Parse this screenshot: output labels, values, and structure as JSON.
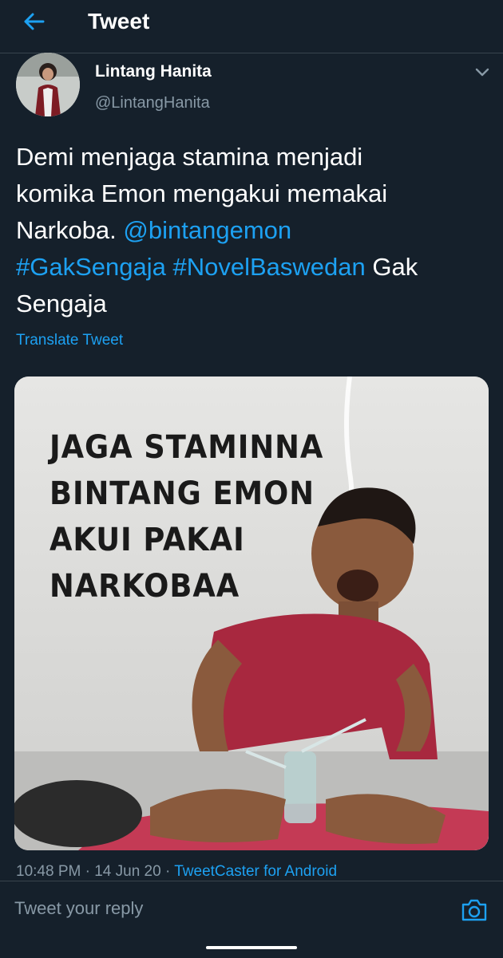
{
  "header": {
    "title": "Tweet"
  },
  "author": {
    "name": "Lintang Hanita",
    "handle": "@LintangHanita"
  },
  "tweet": {
    "line1": "Demi menjaga stamina menjadi",
    "line2": "komika Emon mengakui memakai",
    "line3a": "Narkoba.  ",
    "mention": "@bintangemon",
    "hashtag1": "#GakSengaja",
    "hashtag2": "#NovelBaswedan",
    "line4b": " Gak",
    "line5": "Sengaja"
  },
  "translate_label": "Translate Tweet",
  "media": {
    "lines": [
      "JAGA STAMINNA",
      "BINTANG EMON",
      "AKUI PAKAI",
      "NARKOBAA"
    ]
  },
  "meta": {
    "timestamp": "10:48 PM · 14 Jun 20 · ",
    "source": "TweetCaster for Android"
  },
  "reply": {
    "placeholder": "Tweet your reply"
  },
  "colors": {
    "background": "#15202b",
    "accent": "#1da1f2",
    "muted": "#8899a6",
    "divider": "#38444d"
  }
}
